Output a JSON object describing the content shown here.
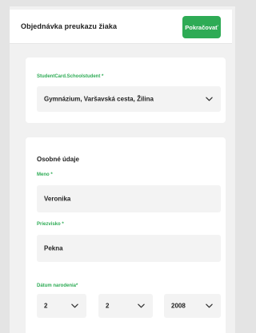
{
  "header": {
    "title": "Objednávka preukazu žiaka",
    "continue_label": "Pokračovať"
  },
  "school": {
    "label": "StudentCard.Schoolstudent *",
    "value": "Gymnázium, Varšavská cesta, Žilina"
  },
  "personal": {
    "section_title": "Osobné údaje",
    "first_name_label": "Meno *",
    "first_name_value": "Veronika",
    "last_name_label": "Priezvisko *",
    "last_name_value": "Pekna",
    "dob_label": "Dátum narodenia*",
    "dob_day": "2",
    "dob_month": "2",
    "dob_year": "2008"
  },
  "colors": {
    "accent": "#2eab55",
    "field_bg": "#f3f3f3"
  },
  "icons": [
    "chevron-down-icon"
  ]
}
